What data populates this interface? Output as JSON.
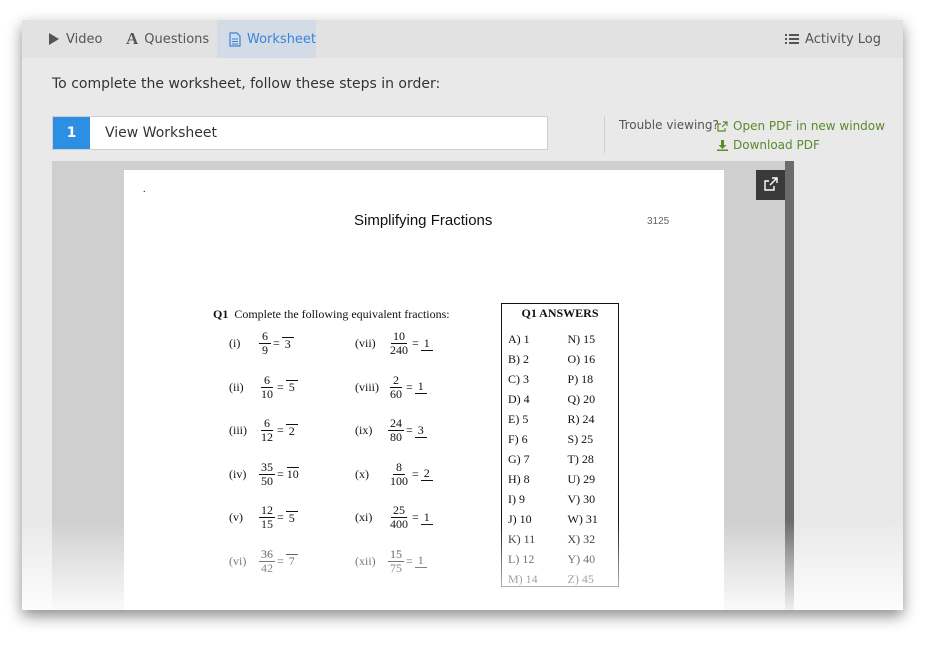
{
  "tabs": {
    "video": "Video",
    "questions": "Questions",
    "worksheet": "Worksheet",
    "activity_log": "Activity Log"
  },
  "instructions": "To complete the worksheet, follow these steps in order:",
  "step": {
    "number": "1",
    "label": "View Worksheet"
  },
  "trouble": "Trouble viewing?",
  "links": {
    "open_pdf": "Open PDF in new window",
    "download_pdf": "Download PDF"
  },
  "colors": {
    "accent": "#2d8fe3",
    "link": "#5a8a2a"
  },
  "worksheet": {
    "dot": ".",
    "title": "Simplifying Fractions",
    "code": "3125",
    "q1_num": "Q1",
    "q1_text": "Complete the following equivalent fractions:",
    "left": [
      {
        "label": "(i)",
        "n": "6",
        "d": "9",
        "bn": "",
        "bd": "3"
      },
      {
        "label": "(ii)",
        "n": "6",
        "d": "10",
        "bn": "",
        "bd": "5"
      },
      {
        "label": "(iii)",
        "n": "6",
        "d": "12",
        "bn": "",
        "bd": "2"
      },
      {
        "label": "(iv)",
        "n": "35",
        "d": "50",
        "bn": "",
        "bd": "10"
      },
      {
        "label": "(v)",
        "n": "12",
        "d": "15",
        "bn": "",
        "bd": "5"
      },
      {
        "label": "(vi)",
        "n": "36",
        "d": "42",
        "bn": "",
        "bd": "7"
      }
    ],
    "right": [
      {
        "label": "(vii)",
        "n": "10",
        "d": "240",
        "bn": "1",
        "bd": ""
      },
      {
        "label": "(viii)",
        "n": "2",
        "d": "60",
        "bn": "1",
        "bd": ""
      },
      {
        "label": "(ix)",
        "n": "24",
        "d": "80",
        "bn": "3",
        "bd": ""
      },
      {
        "label": "(x)",
        "n": "8",
        "d": "100",
        "bn": "2",
        "bd": ""
      },
      {
        "label": "(xi)",
        "n": "25",
        "d": "400",
        "bn": "1",
        "bd": ""
      },
      {
        "label": "(xii)",
        "n": "15",
        "d": "75",
        "bn": "1",
        "bd": ""
      }
    ],
    "answers_title": "Q1 ANSWERS",
    "answers_left": [
      "A)  1",
      "B)  2",
      "C)  3",
      "D)  4",
      "E)  5",
      "F)  6",
      "G)  7",
      "H)  8",
      "I)  9",
      "J)  10",
      "K)  11",
      "L)  12",
      "M)  14"
    ],
    "answers_right": [
      "N)  15",
      "O)  16",
      "P)  18",
      "Q)  20",
      "R)  24",
      "S)  25",
      "T)  28",
      "U)  29",
      "V)  30",
      "W)  31",
      "X)  32",
      "Y)  40",
      "Z)  45"
    ]
  }
}
